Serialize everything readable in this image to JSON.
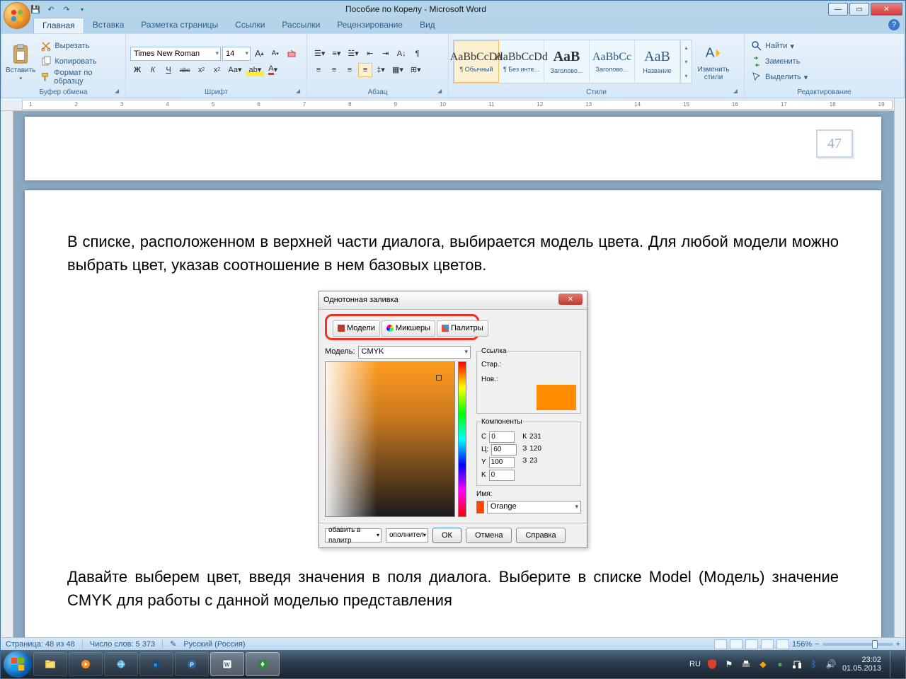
{
  "window": {
    "title": "Пособие по Корелу - Microsoft Word"
  },
  "qat": {
    "save": "💾",
    "undo": "↶",
    "redo": "↷"
  },
  "tabs": [
    "Главная",
    "Вставка",
    "Разметка страницы",
    "Ссылки",
    "Рассылки",
    "Рецензирование",
    "Вид"
  ],
  "ribbon": {
    "clipboard": {
      "label": "Буфер обмена",
      "paste": "Вставить",
      "cut": "Вырезать",
      "copy": "Копировать",
      "format_painter": "Формат по образцу"
    },
    "font": {
      "label": "Шрифт",
      "family": "Times New Roman",
      "size": "14",
      "bold": "Ж",
      "italic": "К",
      "underline": "Ч",
      "strike": "abc",
      "sub": "x₂",
      "sup": "x²",
      "case": "Aa",
      "highlight": "ab",
      "color": "A",
      "grow": "A",
      "shrink": "A",
      "clear": "⌫"
    },
    "paragraph": {
      "label": "Абзац"
    },
    "styles": {
      "label": "Стили",
      "items": [
        {
          "preview": "AaBbCcDd",
          "name": "¶ Обычный"
        },
        {
          "preview": "AaBbCcDd",
          "name": "¶ Без инте..."
        },
        {
          "preview": "AaB",
          "name": "Заголово..."
        },
        {
          "preview": "AaBbCc",
          "name": "Заголово..."
        },
        {
          "preview": "AaB",
          "name": "Название"
        }
      ],
      "change": "Изменить стили"
    },
    "editing": {
      "label": "Редактирование",
      "find": "Найти",
      "replace": "Заменить",
      "select": "Выделить"
    }
  },
  "doc": {
    "page_number_box": "47",
    "para1": "В списке, расположенном в верхней части диалога, выбирается модель цвета. Для любой модели можно выбрать цвет, указав соотношение в нем базовых цветов.",
    "para2": "Давайте выберем цвет, введя значения в поля диалога. Выберите в списке Model (Модель) значение CMYK для работы с данной моделью представления"
  },
  "corel": {
    "title": "Однотонная заливка",
    "tabs": {
      "models": "Модели",
      "mixers": "Микшеры",
      "palettes": "Палитры"
    },
    "model_label": "Модель:",
    "model_value": "CMYK",
    "ref": {
      "legend": "Ссылка",
      "old": "Стар.:",
      "new": "Нов.:"
    },
    "components": {
      "legend": "Компоненты",
      "c": {
        "label": "C",
        "value": "0"
      },
      "m": {
        "label": "Ц:",
        "value": "60"
      },
      "y": {
        "label": "Y",
        "value": "100"
      },
      "k": {
        "label": "K",
        "value": "0"
      },
      "r": {
        "label": "К",
        "value": "231"
      },
      "g": {
        "label": "З",
        "value": "120"
      },
      "b": {
        "label": "З",
        "value": "23"
      }
    },
    "name_label": "Имя:",
    "name_value": "Orange",
    "footer": {
      "add": "обавить в палитр",
      "options": "ополнител",
      "ok": "ОК",
      "cancel": "Отмена",
      "help": "Справка"
    }
  },
  "status": {
    "page": "Страница: 48 из 48",
    "words": "Число слов: 5 373",
    "lang": "Русский (Россия)",
    "zoom": "156%"
  },
  "tray": {
    "lang": "RU",
    "time": "23:02",
    "date": "01.05.2013"
  }
}
